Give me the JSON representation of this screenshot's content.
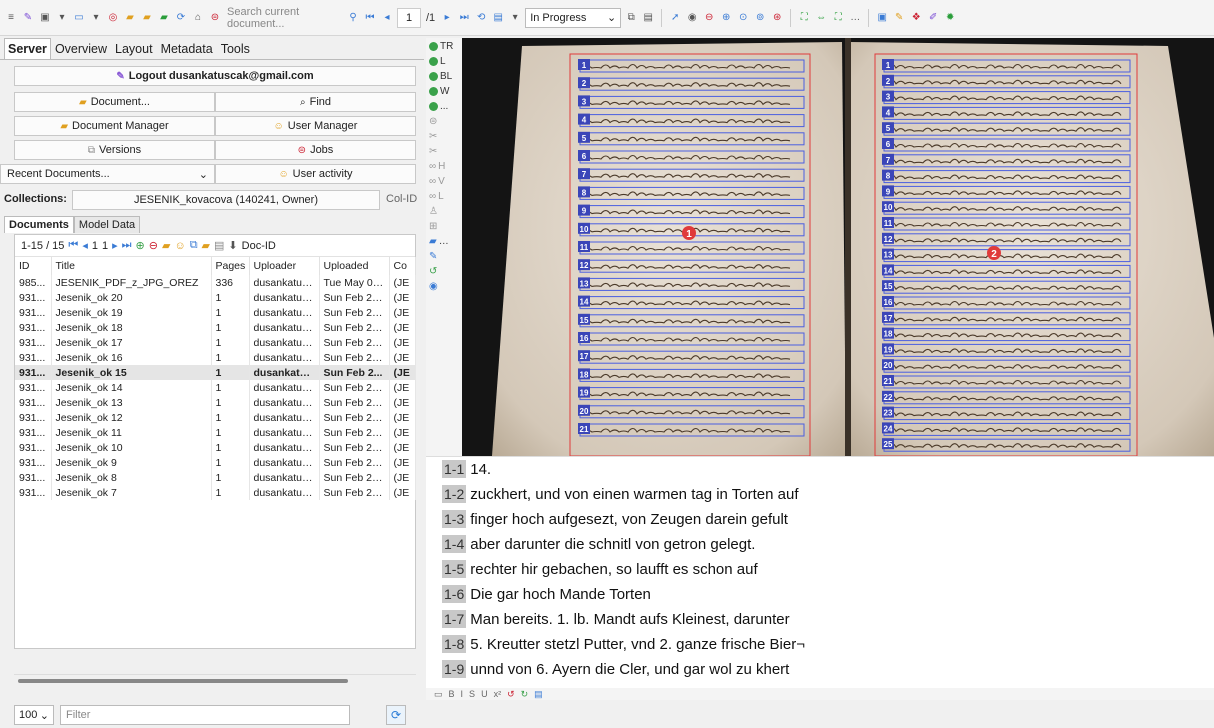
{
  "toolbar": {
    "search_placeholder": "Search current document...",
    "page_current": "1",
    "page_total": "/1",
    "status_select": "In Progress"
  },
  "left": {
    "tabs": [
      "Server",
      "Overview",
      "Layout",
      "Metadata",
      "Tools"
    ],
    "logout_label": "Logout dusankatuscak@gmail.com",
    "buttons": {
      "document": "Document...",
      "find": "Find",
      "document_manager": "Document Manager",
      "user_manager": "User Manager",
      "versions": "Versions",
      "jobs": "Jobs",
      "user_activity": "User activity"
    },
    "recent_documents": "Recent Documents...",
    "collections_label": "Collections:",
    "collection_value": "JESENIK_kovacova (140241, Owner)",
    "col_id_label": "Col-ID",
    "subtabs": [
      "Documents",
      "Model Data"
    ],
    "doc_range": "1-15 / 15",
    "doc_page": "1",
    "doc_page2": "1",
    "doc_id_label": "Doc-ID",
    "columns": [
      "ID",
      "Title",
      "Pages",
      "Uploader",
      "Uploaded",
      "Co"
    ],
    "rows": [
      {
        "id": "985...",
        "title": "JESENIK_PDF_z_JPG_OREZ",
        "pages": "336",
        "uploader": "dusankatus...",
        "uploaded": "Tue May 03...",
        "co": "(JE"
      },
      {
        "id": "931...",
        "title": "Jesenik_ok 20",
        "pages": "1",
        "uploader": "dusankatus...",
        "uploaded": "Sun Feb 27 ...",
        "co": "(JE"
      },
      {
        "id": "931...",
        "title": "Jesenik_ok 19",
        "pages": "1",
        "uploader": "dusankatus...",
        "uploaded": "Sun Feb 27 ...",
        "co": "(JE"
      },
      {
        "id": "931...",
        "title": "Jesenik_ok 18",
        "pages": "1",
        "uploader": "dusankatus...",
        "uploaded": "Sun Feb 27 ...",
        "co": "(JE"
      },
      {
        "id": "931...",
        "title": "Jesenik_ok 17",
        "pages": "1",
        "uploader": "dusankatus...",
        "uploaded": "Sun Feb 27 ...",
        "co": "(JE"
      },
      {
        "id": "931...",
        "title": "Jesenik_ok 16",
        "pages": "1",
        "uploader": "dusankatus...",
        "uploaded": "Sun Feb 27 ...",
        "co": "(JE"
      },
      {
        "id": "931...",
        "title": "Jesenik_ok 15",
        "pages": "1",
        "uploader": "dusankatu...",
        "uploaded": "Sun Feb 2...",
        "co": "(JE",
        "selected": true
      },
      {
        "id": "931...",
        "title": "Jesenik_ok 14",
        "pages": "1",
        "uploader": "dusankatus...",
        "uploaded": "Sun Feb 27 ...",
        "co": "(JE"
      },
      {
        "id": "931...",
        "title": "Jesenik_ok 13",
        "pages": "1",
        "uploader": "dusankatus...",
        "uploaded": "Sun Feb 27 ...",
        "co": "(JE"
      },
      {
        "id": "931...",
        "title": "Jesenik_ok 12",
        "pages": "1",
        "uploader": "dusankatus...",
        "uploaded": "Sun Feb 27 ...",
        "co": "(JE"
      },
      {
        "id": "931...",
        "title": "Jesenik_ok 11",
        "pages": "1",
        "uploader": "dusankatus...",
        "uploaded": "Sun Feb 27 ...",
        "co": "(JE"
      },
      {
        "id": "931...",
        "title": "Jesenik_ok 10",
        "pages": "1",
        "uploader": "dusankatus...",
        "uploaded": "Sun Feb 27 ...",
        "co": "(JE"
      },
      {
        "id": "931...",
        "title": "Jesenik_ok 9",
        "pages": "1",
        "uploader": "dusankatus...",
        "uploaded": "Sun Feb 27 ...",
        "co": "(JE"
      },
      {
        "id": "931...",
        "title": "Jesenik_ok 8",
        "pages": "1",
        "uploader": "dusankatus...",
        "uploaded": "Sun Feb 27 ...",
        "co": "(JE"
      },
      {
        "id": "931...",
        "title": "Jesenik_ok 7",
        "pages": "1",
        "uploader": "dusankatus...",
        "uploaded": "Sun Feb 27 ...",
        "co": "(JE"
      }
    ],
    "page_size": "100",
    "filter_placeholder": "Filter"
  },
  "vertical_tools": [
    "TR",
    "L",
    "BL",
    "W",
    "...",
    "H",
    "V",
    "L"
  ],
  "image": {
    "region_left": "1",
    "region_right": "2",
    "left_lines": [
      "1",
      "2",
      "3",
      "4",
      "5",
      "6",
      "7",
      "8",
      "9",
      "10",
      "11",
      "12",
      "13",
      "14",
      "15",
      "16",
      "17",
      "18",
      "19",
      "20",
      "21"
    ],
    "right_lines": [
      "1",
      "2",
      "3",
      "4",
      "5",
      "6",
      "7",
      "8",
      "9",
      "10",
      "11",
      "12",
      "13",
      "14",
      "15",
      "16",
      "17",
      "18",
      "19",
      "20",
      "21",
      "22",
      "23",
      "24",
      "25"
    ]
  },
  "transcript": [
    {
      "num": "1-1",
      "text": "14."
    },
    {
      "num": "1-2",
      "text": "zuckhert, und von einen warmen tag in Torten auf"
    },
    {
      "num": "1-3",
      "text": "finger hoch aufgesezt, von Zeugen darein gefult"
    },
    {
      "num": "1-4",
      "text": "aber darunter die schnitl von getron gelegt."
    },
    {
      "num": "1-5",
      "text": "rechter hir gebachen, so laufft es schon auf"
    },
    {
      "num": "1-6",
      "text": "Die gar hoch Mande Torten"
    },
    {
      "num": "1-7",
      "text": "Man bereits. 1. lb. Mandt aufs Kleinest, darunter"
    },
    {
      "num": "1-8",
      "text": "5. Kreutter stetzl Putter, vnd 2. ganze frische Bier¬"
    },
    {
      "num": "1-9",
      "text": "unnd von 6. Ayern die Cler, und gar wol zu khert"
    }
  ]
}
